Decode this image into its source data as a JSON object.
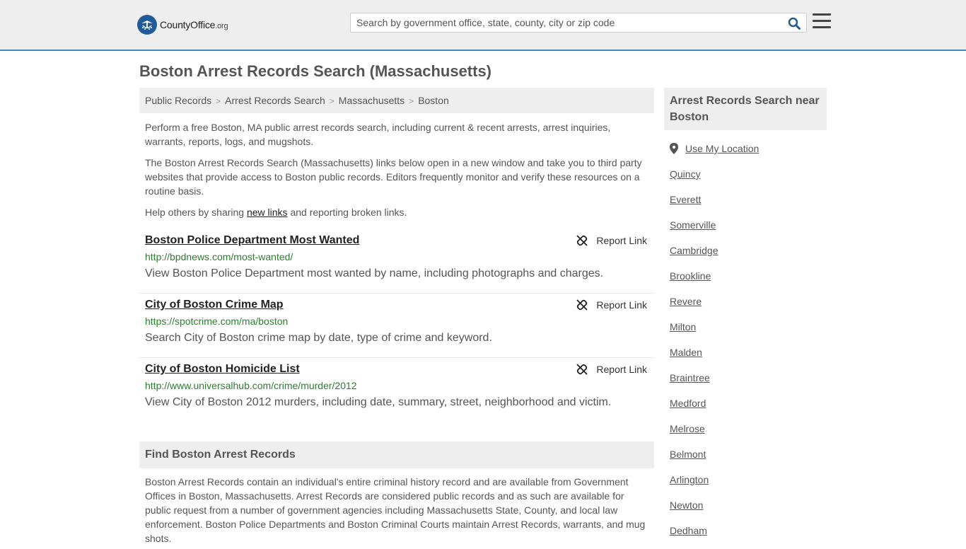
{
  "header": {
    "logo_main": "CountyOffice",
    "logo_suffix": ".org",
    "search_placeholder": "Search by government office, state, county, city or zip code",
    "search_value": "",
    "icons": {
      "search": "search-icon",
      "menu": "hamburger-menu-icon",
      "logo": "seal-icon"
    }
  },
  "page": {
    "title": "Boston Arrest Records Search (Massachusetts)"
  },
  "breadcrumb": [
    "Public Records",
    "Arrest Records Search",
    "Massachusetts",
    "Boston"
  ],
  "intro": {
    "p1": "Perform a free Boston, MA public arrest records search, including current & recent arrests, arrest inquiries, warrants, reports, logs, and mugshots.",
    "p2": "The Boston Arrest Records Search (Massachusetts) links below open in a new window and take you to third party websites that provide access to Boston public records. Editors frequently monitor and verify these resources on a routine basis.",
    "p3_before": "Help others by sharing ",
    "p3_link": "new links",
    "p3_after": " and reporting broken links."
  },
  "results": [
    {
      "title": "Boston Police Department Most Wanted",
      "url": "http://bpdnews.com/most-wanted/",
      "description": "View Boston Police Department most wanted by name, including photographs and charges.",
      "report_label": "Report Link"
    },
    {
      "title": "City of Boston Crime Map",
      "url": "https://spotcrime.com/ma/boston",
      "description": "Search City of Boston crime map by date, type of crime and keyword.",
      "report_label": "Report Link"
    },
    {
      "title": "City of Boston Homicide List",
      "url": "http://www.universalhub.com/crime/murder/2012",
      "description": "View City of Boston 2012 murders, including date, summary, street, neighborhood and victim.",
      "report_label": "Report Link"
    }
  ],
  "find_section": {
    "heading": "Find Boston Arrest Records",
    "body": "Boston Arrest Records contain an individual's entire criminal history record and are available from Government Offices in Boston, Massachusetts. Arrest Records are considered public records and as such are available for public request from a number of government agencies including Massachusetts State, County, and local law enforcement. Boston Police Departments and Boston Criminal Courts maintain Arrest Records, warrants, and mug shots."
  },
  "sidebar": {
    "heading": "Arrest Records Search near Boston",
    "use_location": "Use My Location",
    "cities": [
      "Quincy",
      "Everett",
      "Somerville",
      "Cambridge",
      "Brookline",
      "Revere",
      "Milton",
      "Malden",
      "Braintree",
      "Medford",
      "Melrose",
      "Belmont",
      "Arlington",
      "Newton",
      "Dedham"
    ]
  },
  "colors": {
    "header_bg": "#eeeeee",
    "header_border": "#3f88c5",
    "url_green": "#2e7d32",
    "text_gray": "#555555",
    "seal_blue": "#1f5c99"
  }
}
